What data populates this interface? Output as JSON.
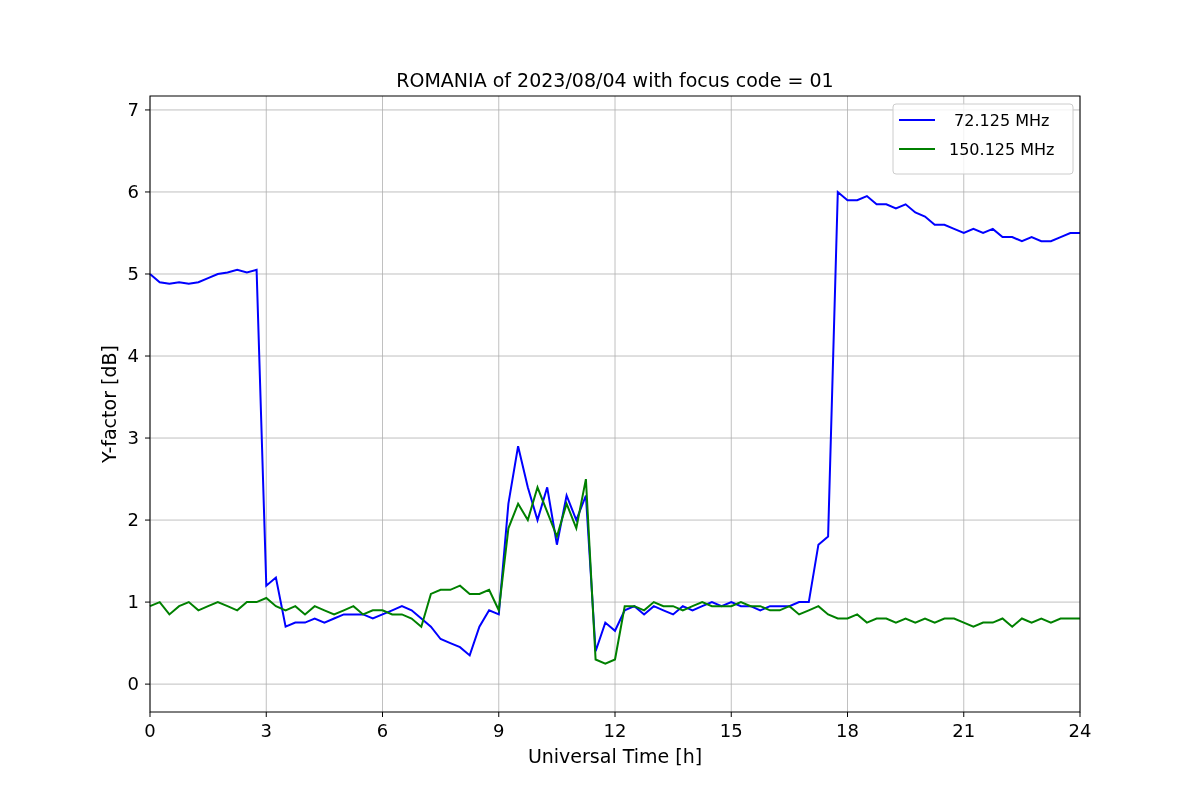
{
  "chart_data": {
    "type": "line",
    "title": "ROMANIA of 2023/08/04 with focus code = 01",
    "xlabel": "Universal Time [h]",
    "ylabel": "Y-factor [dB]",
    "x": [
      0,
      0.25,
      0.5,
      0.75,
      1,
      1.25,
      1.5,
      1.75,
      2,
      2.25,
      2.5,
      2.75,
      3,
      3.25,
      3.5,
      3.75,
      4,
      4.25,
      4.5,
      4.75,
      5,
      5.25,
      5.5,
      5.75,
      6,
      6.25,
      6.5,
      6.75,
      7,
      7.25,
      7.5,
      7.75,
      8,
      8.25,
      8.5,
      8.75,
      9,
      9.25,
      9.5,
      9.75,
      10,
      10.25,
      10.5,
      10.75,
      11,
      11.25,
      11.5,
      11.75,
      12,
      12.25,
      12.5,
      12.75,
      13,
      13.25,
      13.5,
      13.75,
      14,
      14.25,
      14.5,
      14.75,
      15,
      15.25,
      15.5,
      15.75,
      16,
      16.25,
      16.5,
      16.75,
      17,
      17.25,
      17.5,
      17.75,
      18,
      18.25,
      18.5,
      18.75,
      19,
      19.25,
      19.5,
      19.75,
      20,
      20.25,
      20.5,
      20.75,
      21,
      21.25,
      21.5,
      21.75,
      22,
      22.25,
      22.5,
      22.75,
      23,
      23.25,
      23.5,
      23.75,
      24
    ],
    "series": [
      {
        "name": " 72.125 MHz",
        "color": "#0000ff",
        "values": [
          5.0,
          4.9,
          4.88,
          4.9,
          4.88,
          4.9,
          4.95,
          5.0,
          5.02,
          5.05,
          5.02,
          5.05,
          1.2,
          1.3,
          0.7,
          0.75,
          0.75,
          0.8,
          0.75,
          0.8,
          0.85,
          0.85,
          0.85,
          0.8,
          0.85,
          0.9,
          0.95,
          0.9,
          0.8,
          0.7,
          0.55,
          0.5,
          0.45,
          0.35,
          0.7,
          0.9,
          0.85,
          2.2,
          2.9,
          2.4,
          2.0,
          2.4,
          1.7,
          2.3,
          2.0,
          2.3,
          0.4,
          0.75,
          0.65,
          0.9,
          0.95,
          0.85,
          0.95,
          0.9,
          0.85,
          0.95,
          0.9,
          0.95,
          1.0,
          0.95,
          1.0,
          0.95,
          0.95,
          0.9,
          0.95,
          0.95,
          0.95,
          1.0,
          1.0,
          1.7,
          1.8,
          6.0,
          5.9,
          5.9,
          5.95,
          5.85,
          5.85,
          5.8,
          5.85,
          5.75,
          5.7,
          5.6,
          5.6,
          5.55,
          5.5,
          5.55,
          5.5,
          5.55,
          5.45,
          5.45,
          5.4,
          5.45,
          5.4,
          5.4,
          5.45,
          5.5,
          5.5
        ]
      },
      {
        "name": "150.125 MHz",
        "color": "#008000",
        "values": [
          0.95,
          1.0,
          0.85,
          0.95,
          1.0,
          0.9,
          0.95,
          1.0,
          0.95,
          0.9,
          1.0,
          1.0,
          1.05,
          0.95,
          0.9,
          0.95,
          0.85,
          0.95,
          0.9,
          0.85,
          0.9,
          0.95,
          0.85,
          0.9,
          0.9,
          0.85,
          0.85,
          0.8,
          0.7,
          1.1,
          1.15,
          1.15,
          1.2,
          1.1,
          1.1,
          1.15,
          0.9,
          1.9,
          2.2,
          2.0,
          2.4,
          2.1,
          1.8,
          2.2,
          1.9,
          2.5,
          0.3,
          0.25,
          0.3,
          0.95,
          0.95,
          0.9,
          1.0,
          0.95,
          0.95,
          0.9,
          0.95,
          1.0,
          0.95,
          0.95,
          0.95,
          1.0,
          0.95,
          0.95,
          0.9,
          0.9,
          0.95,
          0.85,
          0.9,
          0.95,
          0.85,
          0.8,
          0.8,
          0.85,
          0.75,
          0.8,
          0.8,
          0.75,
          0.8,
          0.75,
          0.8,
          0.75,
          0.8,
          0.8,
          0.75,
          0.7,
          0.75,
          0.75,
          0.8,
          0.7,
          0.8,
          0.75,
          0.8,
          0.75,
          0.8,
          0.8,
          0.8
        ]
      }
    ],
    "xlim": [
      0,
      24
    ],
    "ylim": [
      -0.34,
      7.17
    ],
    "xticks": [
      0,
      3,
      6,
      9,
      12,
      15,
      18,
      21,
      24
    ],
    "yticks": [
      0,
      1,
      2,
      3,
      4,
      5,
      6,
      7
    ],
    "grid": true,
    "legend": true
  }
}
